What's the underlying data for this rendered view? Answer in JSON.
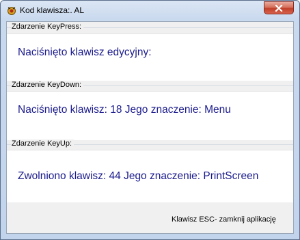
{
  "window": {
    "title": "Kod klawisza:. AL",
    "icon": "app-icon"
  },
  "groups": [
    {
      "label": "Zdarzenie KeyPress:",
      "text": "Naciśnięto klawisz edycyjny:"
    },
    {
      "label": "Zdarzenie KeyDown:",
      "text": "Naciśnięto klawisz: 18 Jego znaczenie: Menu"
    },
    {
      "label": "Zdarzenie KeyUp:",
      "text": "Zwolniono klawisz: 44 Jego znaczenie: PrintScreen"
    }
  ],
  "footer": {
    "hint": "Klawisz ESC- zamknij aplikację"
  },
  "colors": {
    "accent_text": "#1a1a8c",
    "close_button": "#c1402a"
  }
}
